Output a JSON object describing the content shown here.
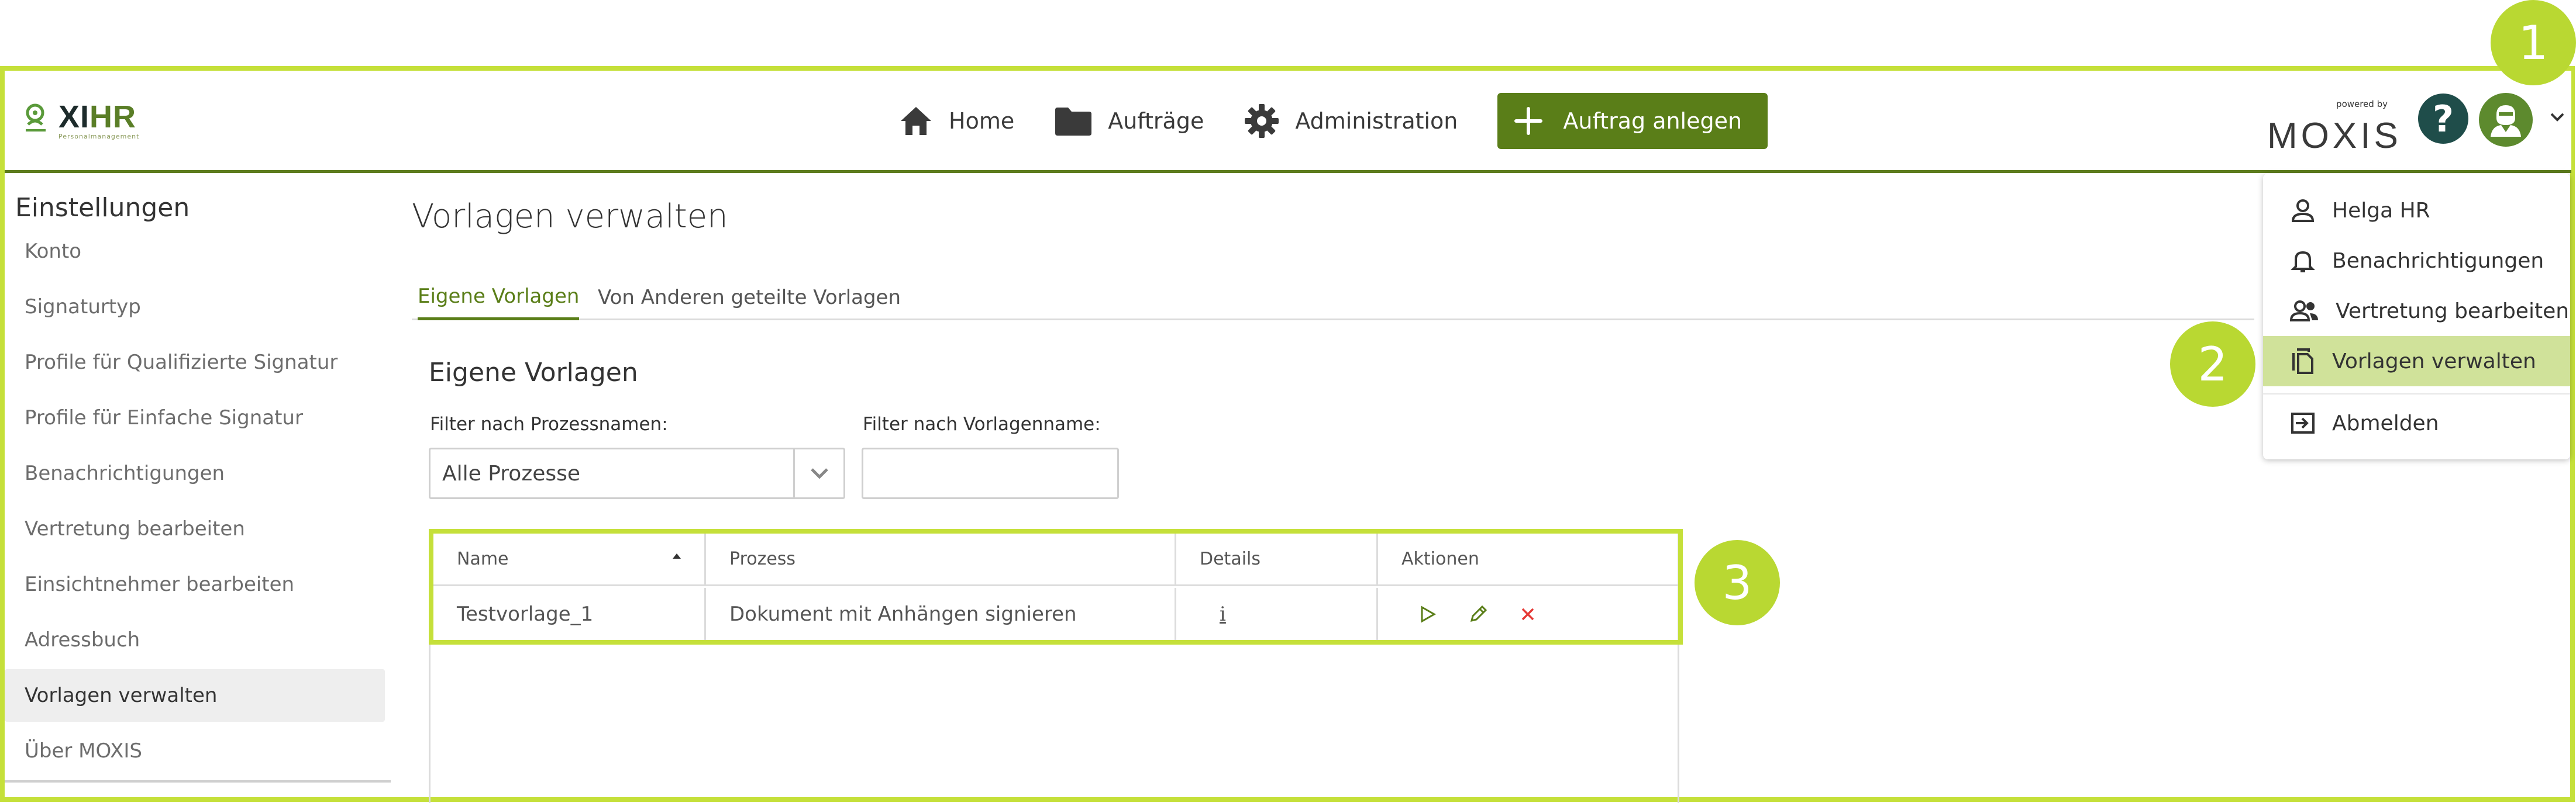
{
  "annotations": [
    "1",
    "2",
    "3"
  ],
  "colors": {
    "accent": "#5a7e18",
    "highlight": "#c5e03a",
    "badge": "#b9d832",
    "help": "#1f4d4a"
  },
  "logo": {
    "main": "XI",
    "accent": "HR",
    "sub": "Personalmanagement"
  },
  "nav": {
    "items": [
      {
        "label": "Home",
        "icon": "home-icon"
      },
      {
        "label": "Aufträge",
        "icon": "folder-icon"
      },
      {
        "label": "Administration",
        "icon": "gear-icon"
      }
    ],
    "primary_button": {
      "label": "Auftrag anlegen",
      "icon": "plus-icon"
    }
  },
  "brand": {
    "powered_by": "powered by",
    "name": "MOXIS"
  },
  "help_label": "?",
  "sidebar": {
    "title": "Einstellungen",
    "items": [
      {
        "label": "Konto"
      },
      {
        "label": "Signaturtyp"
      },
      {
        "label": "Profile für Qualifizierte Signatur"
      },
      {
        "label": "Profile für Einfache Signatur"
      },
      {
        "label": "Benachrichtigungen"
      },
      {
        "label": "Vertretung bearbeiten"
      },
      {
        "label": "Einsichtnehmer bearbeiten"
      },
      {
        "label": "Adressbuch"
      },
      {
        "label": "Vorlagen verwalten",
        "active": true
      },
      {
        "label": "Über MOXIS"
      }
    ]
  },
  "main": {
    "title": "Vorlagen verwalten",
    "tabs": [
      {
        "label": "Eigene Vorlagen",
        "active": true
      },
      {
        "label": "Von Anderen geteilte Vorlagen"
      }
    ],
    "section_title": "Eigene Vorlagen",
    "filters": {
      "process_label": "Filter nach Prozessnamen:",
      "process_value": "Alle Prozesse",
      "template_label": "Filter nach Vorlagenname:",
      "template_value": ""
    },
    "table": {
      "headers": [
        "Name",
        "Prozess",
        "Details",
        "Aktionen"
      ],
      "rows": [
        {
          "name": "Testvorlage_1",
          "process": "Dokument mit Anhängen signieren",
          "details": "i"
        }
      ]
    }
  },
  "user_menu": {
    "items": [
      {
        "label": "Helga HR",
        "icon": "person-icon"
      },
      {
        "label": "Benachrichtigungen",
        "icon": "bell-icon"
      },
      {
        "label": "Vertretung bearbeiten",
        "icon": "people-icon"
      },
      {
        "label": "Vorlagen verwalten",
        "icon": "copy-icon",
        "active": true
      },
      {
        "label": "Abmelden",
        "icon": "logout-icon"
      }
    ]
  }
}
